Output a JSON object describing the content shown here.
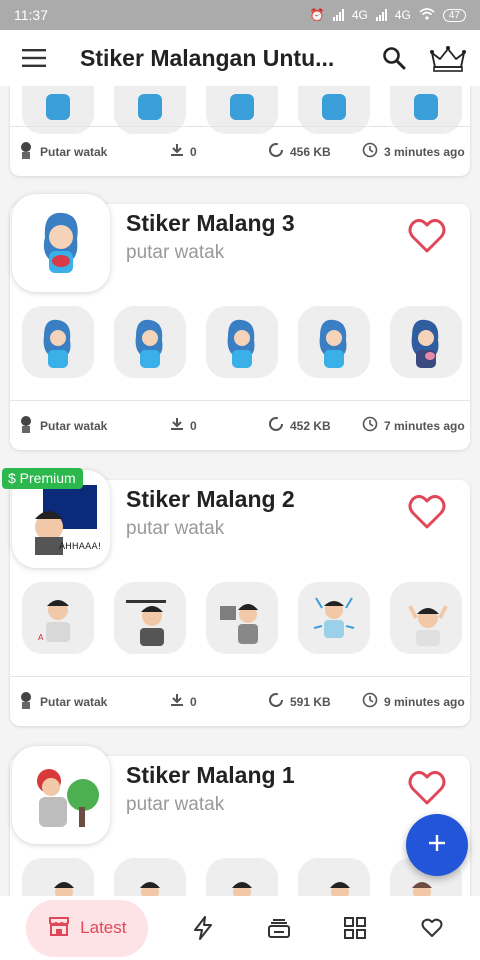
{
  "status_bar": {
    "time": "11:37",
    "network_1": "4G",
    "network_2": "4G",
    "battery": "47"
  },
  "app_bar": {
    "title": "Stiker Malangan Untu...",
    "menu_icon": "menu-icon",
    "search_icon": "search-icon",
    "crown_icon": "crown-icon"
  },
  "packs": [
    {
      "name": "",
      "author": "",
      "meta": {
        "author": "Putar watak",
        "downloads": "0",
        "size": "456 KB",
        "time": "3 minutes ago"
      }
    },
    {
      "name": "Stiker Malang 3",
      "author": "putar watak",
      "premium": "",
      "meta": {
        "author": "Putar watak",
        "downloads": "0",
        "size": "452 KB",
        "time": "7 minutes ago"
      }
    },
    {
      "name": "Stiker Malang 2",
      "author": "putar watak",
      "premium": "$ Premium",
      "meta": {
        "author": "Putar watak",
        "downloads": "0",
        "size": "591 KB",
        "time": "9 minutes ago"
      }
    },
    {
      "name": "Stiker Malang 1",
      "author": "putar watak",
      "premium": ""
    }
  ],
  "fab_icon": "plus-icon",
  "bottom_nav": {
    "latest_label": "Latest",
    "items": [
      "store-icon",
      "flash-icon",
      "stack-icon",
      "grid-icon",
      "heart-icon"
    ]
  },
  "colors": {
    "accent": "#e0485a",
    "fab": "#2255d8",
    "premium": "#2db84d",
    "heart": "#e0485a"
  }
}
